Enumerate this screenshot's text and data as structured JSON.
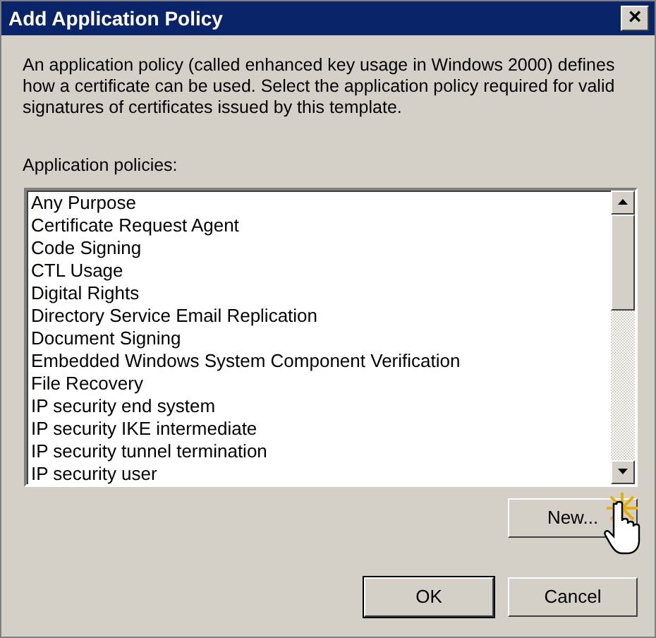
{
  "window": {
    "title": "Add Application Policy",
    "close": "×"
  },
  "description": "An application policy (called enhanced key usage in Windows 2000) defines how a certificate can be used. Select the application policy required for valid signatures of certificates issued by this template.",
  "list_label": "Application policies:",
  "policies": [
    {
      "label": "Any Purpose",
      "selected": false
    },
    {
      "label": "Certificate Request Agent",
      "selected": false
    },
    {
      "label": "Code Signing",
      "selected": false
    },
    {
      "label": "CTL Usage",
      "selected": false
    },
    {
      "label": "Digital Rights",
      "selected": false
    },
    {
      "label": "Directory Service Email Replication",
      "selected": false
    },
    {
      "label": "Document Signing",
      "selected": false
    },
    {
      "label": "Embedded Windows System Component Verification",
      "selected": false
    },
    {
      "label": "File Recovery",
      "selected": false
    },
    {
      "label": "IP security end system",
      "selected": false
    },
    {
      "label": "IP security IKE intermediate",
      "selected": false
    },
    {
      "label": "IP security tunnel termination",
      "selected": false
    },
    {
      "label": "IP security user",
      "selected": false
    }
  ],
  "buttons": [
    {
      "label": "New...",
      "kind": "new"
    },
    {
      "label": "OK",
      "kind": "default"
    },
    {
      "label": "Cancel",
      "kind": "normal"
    }
  ]
}
